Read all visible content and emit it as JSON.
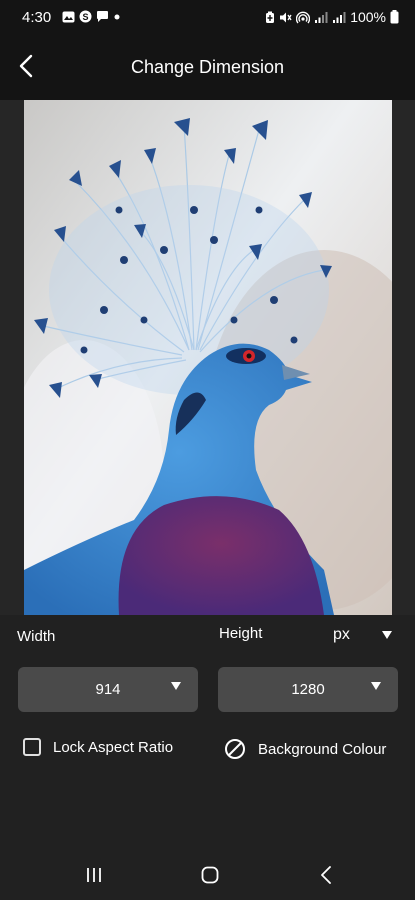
{
  "status_bar": {
    "time": "4:30",
    "battery_text": "100%",
    "left_icons": [
      "gallery-icon",
      "skype-icon",
      "chat-icon",
      "dot-icon"
    ],
    "right_icons": [
      "battery-saver-icon",
      "mute-icon",
      "hotspot-icon",
      "signal-icon",
      "signal-icon",
      "battery-icon"
    ]
  },
  "header": {
    "title": "Change Dimension",
    "back_icon": "chevron-left-icon"
  },
  "image": {
    "subject": "Victoria crowned pigeon",
    "colors": {
      "bird": "#3f8fd4",
      "crest": "#9fc6e8",
      "breast": "#6e3a7a",
      "background": "#d9dce0"
    }
  },
  "controls": {
    "width_label": "Width",
    "height_label": "Height",
    "unit": "px",
    "width_value": "914",
    "height_value": "1280",
    "lock_aspect_label": "Lock Aspect Ratio",
    "lock_aspect_checked": false,
    "background_colour_label": "Background Colour"
  },
  "nav": {
    "recents_icon": "recents-icon",
    "home_icon": "home-icon",
    "back_icon": "back-icon"
  },
  "colors": {
    "bar_bg": "#141414",
    "page_bg": "#212121",
    "dropdown_bg": "#4a4a4a",
    "text": "#ffffff"
  }
}
